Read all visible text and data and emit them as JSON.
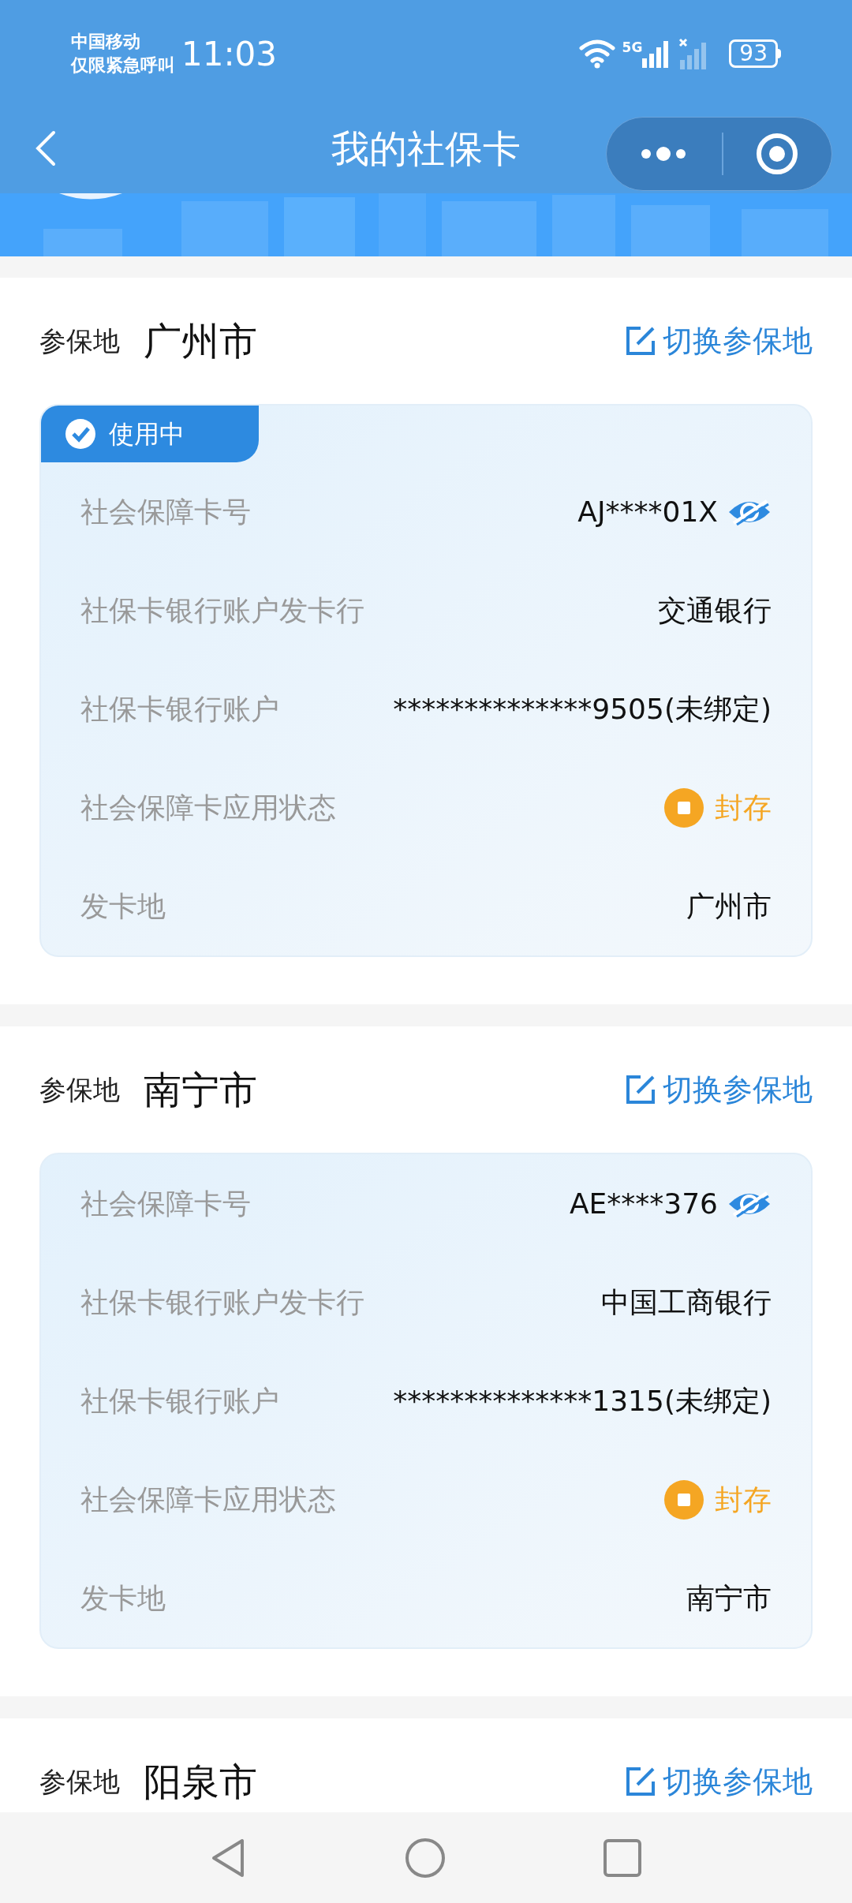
{
  "status_bar": {
    "carrier_line_1": "中国移动",
    "carrier_line_2": "仅限紧急呼叫",
    "time": "11:03",
    "network": "5G",
    "battery": "93"
  },
  "header": {
    "title": "我的社保卡"
  },
  "sections": [
    {
      "label": "参保地",
      "city": "广州市",
      "switch_link": "切换参保地",
      "card": {
        "in_use": true,
        "badge": "使用中",
        "rows": [
          {
            "kind": "masked",
            "label": "社会保障卡号",
            "value": "AJ****01X"
          },
          {
            "kind": "text",
            "label": "社保卡银行账户发卡行",
            "value": "交通银行"
          },
          {
            "kind": "text",
            "label": "社保卡银行账户",
            "value": "**************9505(未绑定)"
          },
          {
            "kind": "status",
            "label": "社会保障卡应用状态",
            "value": "封存",
            "color": "#f5a623"
          },
          {
            "kind": "text",
            "label": "发卡地",
            "value": "广州市"
          }
        ]
      }
    },
    {
      "label": "参保地",
      "city": "南宁市",
      "switch_link": "切换参保地",
      "card": {
        "in_use": false,
        "rows": [
          {
            "kind": "masked",
            "label": "社会保障卡号",
            "value": "AE****376"
          },
          {
            "kind": "text",
            "label": "社保卡银行账户发卡行",
            "value": "中国工商银行"
          },
          {
            "kind": "text",
            "label": "社保卡银行账户",
            "value": "**************1315(未绑定)"
          },
          {
            "kind": "status",
            "label": "社会保障卡应用状态",
            "value": "封存",
            "color": "#f5a623"
          },
          {
            "kind": "text",
            "label": "发卡地",
            "value": "南宁市"
          }
        ]
      }
    },
    {
      "label": "参保地",
      "city": "阳泉市",
      "switch_link": "切换参保地"
    }
  ]
}
